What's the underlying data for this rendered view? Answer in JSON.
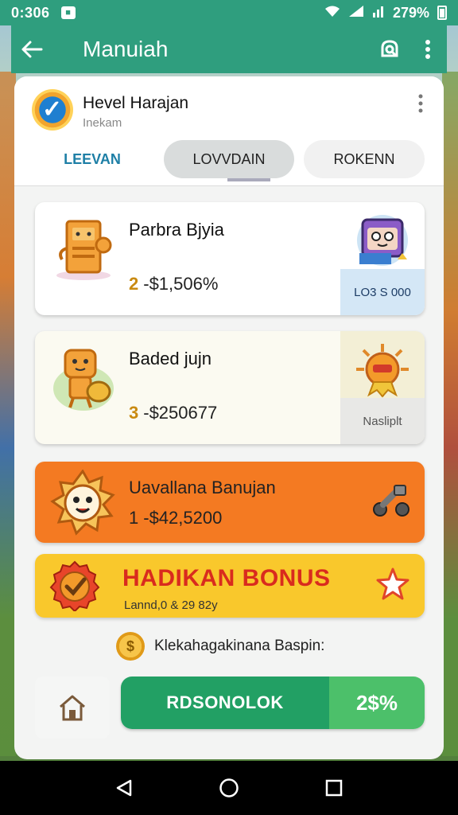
{
  "status_bar": {
    "time": "0:306",
    "notification": "■",
    "battery_text": "279%"
  },
  "app_bar": {
    "title": "Manuiah"
  },
  "header": {
    "title": "Hevel Harajan",
    "subtitle": "Inekam"
  },
  "tabs": [
    {
      "label": "LEEVAN",
      "selected": false
    },
    {
      "label": "LOVVDAIN",
      "selected": true
    },
    {
      "label": "ROKENN",
      "selected": false
    }
  ],
  "items": [
    {
      "title": "Parbra Bjyia",
      "rank": "2",
      "value": "-$1,506%",
      "badge": "LO3 S 000"
    },
    {
      "title": "Baded jujn",
      "rank": "3",
      "value": "-$250677",
      "badge": "Nasliplt"
    },
    {
      "title": "Uavallana Banujan",
      "rank": "1",
      "value": "-$42,5200"
    }
  ],
  "bonus": {
    "title": "HADIKAN BONUS",
    "subtitle": "Lannd,0 & 29 82y"
  },
  "coin_row": {
    "coin_symbol": "$",
    "text": "Klekahagakinana Baspin:"
  },
  "cta": {
    "label": "RDSONOLOK",
    "value": "2$%"
  },
  "colors": {
    "primary": "#2f9e7e",
    "orange": "#f47a22",
    "yellow": "#f9c82c",
    "green": "#22a064",
    "bonus_red": "#d92b1e"
  },
  "icons": [
    "back-arrow-icon",
    "search-icon",
    "more-icon",
    "home-icon",
    "star-icon",
    "coin-icon",
    "nav-back-icon",
    "nav-home-icon",
    "nav-recents-icon"
  ]
}
